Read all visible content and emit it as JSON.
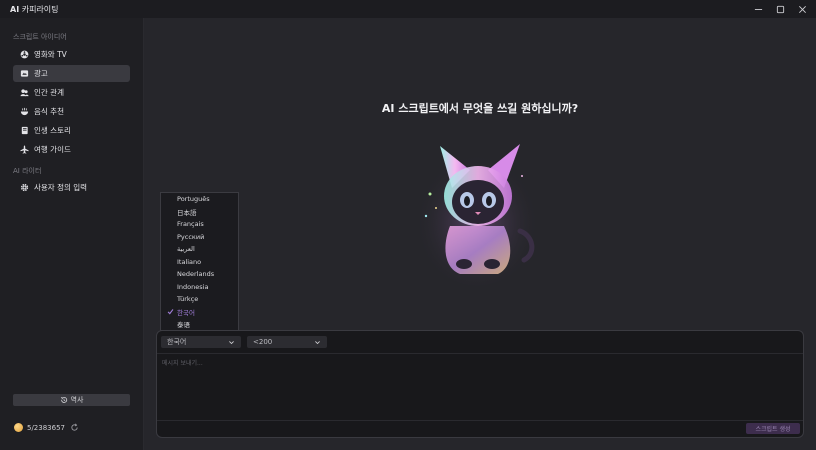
{
  "app": {
    "title_ai": "AI",
    "title_rest": "카피라이팅"
  },
  "sidebar": {
    "section_script_ideas": "스크립트 아이디어",
    "items": [
      {
        "label": "영화와 TV",
        "icon": "film-icon"
      },
      {
        "label": "광고",
        "icon": "ad-icon"
      },
      {
        "label": "인간 관계",
        "icon": "people-icon"
      },
      {
        "label": "음식 추천",
        "icon": "food-icon"
      },
      {
        "label": "인생 스토리",
        "icon": "book-icon"
      },
      {
        "label": "여행 가이드",
        "icon": "plane-icon"
      }
    ],
    "section_ai_writer": "AI 라이터",
    "custom_item": {
      "label": "사용자 정의 입력",
      "icon": "gear-icon"
    },
    "history_label": "역사",
    "credits": "5/2383657"
  },
  "main": {
    "headline_ai": "AI",
    "headline_rest": "스크립트에서 무엇을 쓰길 원하십니까?"
  },
  "composer": {
    "language_value": "한국어",
    "length_value": "<200",
    "message_placeholder": "메시지 보내기...",
    "generate_label": "스크립트 생성"
  },
  "language_menu": {
    "options": [
      "Português",
      "日本語",
      "Français",
      "Русский",
      "العربية",
      "Italiano",
      "Nederlands",
      "Indonesia",
      "Türkçe",
      "한국어",
      "泰语"
    ],
    "selected": "한국어",
    "selected_color": "#a07dd8"
  },
  "colors": {
    "accent": "#a07dd8",
    "active_item": "#3a3a40",
    "generate_button": "#3d2d4d"
  }
}
